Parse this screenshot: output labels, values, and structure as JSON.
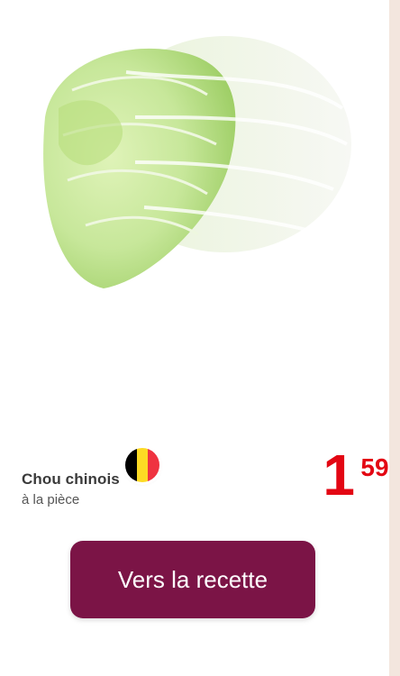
{
  "product": {
    "name": "Chou chinois",
    "unit": "à la pièce",
    "origin_flag": "belgium-flag-icon",
    "flag_colors": [
      "#000000",
      "#fdda24",
      "#ef3340"
    ],
    "image": "chinese-cabbage-image"
  },
  "price": {
    "euros": "1",
    "cents": "59",
    "color": "#e30613"
  },
  "cta": {
    "label": "Vers la recette",
    "color": "#7b1446"
  }
}
